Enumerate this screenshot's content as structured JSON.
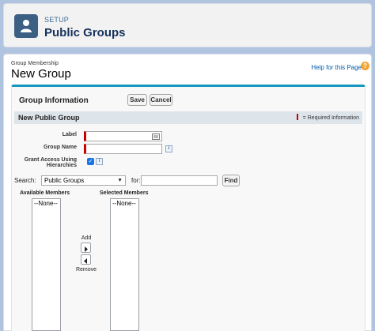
{
  "header": {
    "eyebrow": "SETUP",
    "title": "Public Groups",
    "icon": "groups-icon"
  },
  "page": {
    "eyebrow": "Group Membership",
    "title": "New Group",
    "help_link": "Help for this Page",
    "help_icon": "?"
  },
  "block": {
    "title": "Group Information",
    "save_label": "Save",
    "cancel_label": "Cancel"
  },
  "section": {
    "title": "New Public Group",
    "required_legend": "= Required Information"
  },
  "form": {
    "label_label": "Label",
    "label_value": "",
    "group_name_label": "Group Name",
    "group_name_value": "",
    "grant_access_label_1": "Grant Access Using",
    "grant_access_label_2": "Hierarchies",
    "grant_access_checked": true,
    "info_glyph": "i"
  },
  "search": {
    "label": "Search:",
    "selected": "Public Groups",
    "for_label": "for:",
    "query": "",
    "find_label": "Find"
  },
  "members": {
    "available_title": "Available Members",
    "selected_title": "Selected Members",
    "available_items": [
      "--None--"
    ],
    "selected_items": [
      "--None--"
    ],
    "add_label": "Add",
    "remove_label": "Remove"
  },
  "colors": {
    "accent": "#1797c0",
    "required": "#cc0000",
    "header_icon_bg": "#3c5f84"
  }
}
